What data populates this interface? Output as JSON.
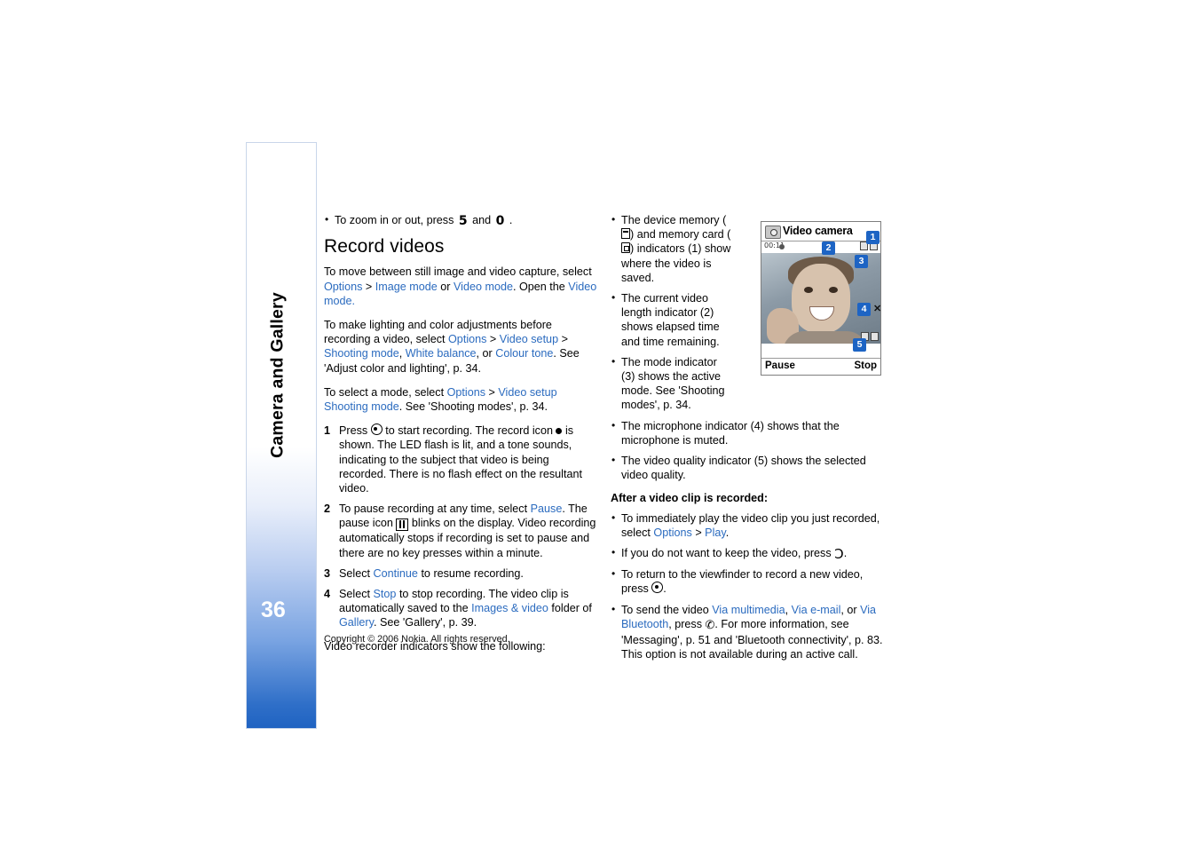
{
  "sidebar": {
    "chapter_title": "Camera and Gallery",
    "page_number": "36"
  },
  "left_column": {
    "zoom_bullet_pre": "To zoom in or out, press",
    "zoom_key_1": "5",
    "zoom_and": "and",
    "zoom_key_2": "0",
    "zoom_bullet_post": ".",
    "section_title": "Record videos",
    "p1_a": "To move between still image and video capture, select",
    "p1_options": "Options",
    "p1_gt1": ">",
    "p1_image_mode": "Image mode",
    "p1_or": "or",
    "p1_video_mode": "Video mode",
    "p1_b": ". Open the",
    "p1_video_mode2": "Video mode",
    "p1_c": ".",
    "p2_a": "To make lighting and color adjustments before recording a video, select",
    "p2_options": "Options",
    "p2_video_setup": "Video setup",
    "p2_shooting_mode": "Shooting mode",
    "p2_b": ",",
    "p2_white_balance": "White balance",
    "p2_c": ", or",
    "p2_colour_tone": "Colour tone",
    "p2_d": ". See 'Adjust color and lighting', p. 34.",
    "p3_a": "To select a mode, select",
    "p3_options": "Options",
    "p3_video_setup": "Video setup",
    "p3_b": ". See 'Shooting modes', p. 34.",
    "p3_shooting_mode": "Shooting mode",
    "steps": [
      {
        "pre": "Press",
        "post": "to start recording. The record icon",
        "tail": "is shown. The LED flash is lit, and a tone sounds, indicating to the subject that video is being recorded. There is no flash effect on the resultant video."
      },
      {
        "pre": "To pause recording at any time, select",
        "link": "Pause",
        "post": ". The pause icon",
        "tail": "blinks on the display. Video recording automatically stops if recording is set to pause and there are no key presses within a minute."
      },
      {
        "pre": "Select",
        "link": "Continue",
        "post": "to resume recording."
      },
      {
        "pre": "Select",
        "link": "Stop",
        "post": "to stop recording. The video clip is automatically saved to the",
        "link2": "Images & video",
        "mid": "folder of",
        "link3": "Gallery",
        "tail": ". See 'Gallery', p. 39."
      }
    ],
    "p4": "Video recorder indicators show the following:"
  },
  "right_column": {
    "bullets": [
      {
        "a": "The device memory (",
        "b": ") and memory card (",
        "c": ") indicators (1) show where the video is saved."
      },
      {
        "text": "The current video length indicator (2) shows elapsed time and time remaining."
      },
      {
        "text": "The mode indicator (3) shows the active mode. See 'Shooting modes', p. 34."
      },
      {
        "text": "The microphone indicator (4) shows that the microphone is muted."
      },
      {
        "text": "The video quality indicator (5) shows the selected video quality."
      }
    ],
    "sub_title": "After a video clip is recorded:",
    "bullets2": [
      {
        "a": "To immediately play the video clip you just recorded, select",
        "link1": "Options",
        "gt": ">",
        "link2": "Play",
        "b": "."
      },
      {
        "a": "If you do not want to keep the video, press",
        "b": "."
      },
      {
        "a": "To return to the viewfinder to record a new video, press",
        "b": "."
      },
      {
        "a": "To send the video",
        "link1": "Via multimedia",
        "sep1": ",",
        "link2": "Via e-mail",
        "sep2": ", or",
        "link3": "Via Bluetooth",
        "b": ", press",
        "c": ". For more information, see 'Messaging', p. 51 and 'Bluetooth connectivity', p. 83. This option is not available during an active call."
      }
    ]
  },
  "phone_figure": {
    "title": "Video camera",
    "timecode": "00:11",
    "soft_left": "Pause",
    "soft_right": "Stop",
    "callouts": [
      "1",
      "2",
      "3",
      "4",
      "5"
    ],
    "mic_mute_glyph": "✕"
  },
  "footer": {
    "copyright": "Copyright © 2006 Nokia. All rights reserved."
  },
  "colors": {
    "link": "#2b6bbf",
    "callout_bg": "#1d64c4",
    "sidebar_accent": "#1f63c2"
  }
}
